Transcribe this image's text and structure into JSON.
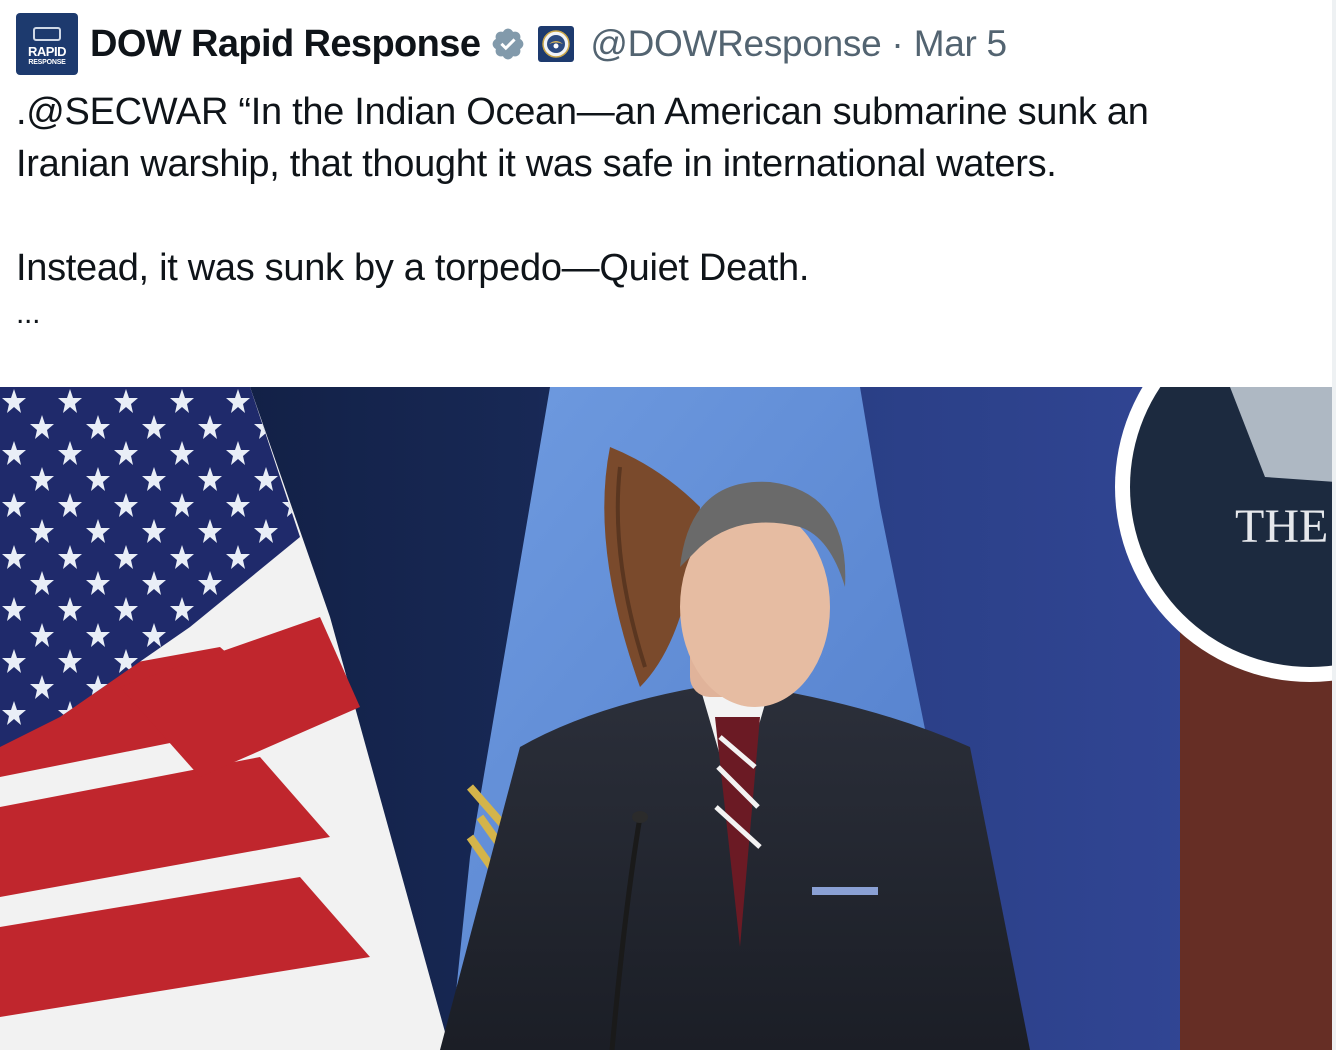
{
  "avatar": {
    "line1": "RAPID",
    "line2": "RESPONSE"
  },
  "author": {
    "name": "DOW Rapid Response",
    "handle": "@DOWResponse",
    "separator": "·",
    "date": "Mar 5"
  },
  "icons": {
    "verified": "verified-badge-icon",
    "affiliation": "dow-seal-icon"
  },
  "tweet": {
    "line1": ".@SECWAR “In the Indian Ocean—an American submarine sunk an",
    "line2": "Iranian warship, that thought it was safe in international waters.",
    "line3": "Instead, it was sunk by a torpedo—Quiet Death.",
    "ellipsis": "..."
  },
  "media": {
    "wall_sign_text": "THE"
  },
  "colors": {
    "name": "#0f1419",
    "meta": "#536471",
    "verified": "#829aab",
    "seal": "#1d3a6e"
  }
}
